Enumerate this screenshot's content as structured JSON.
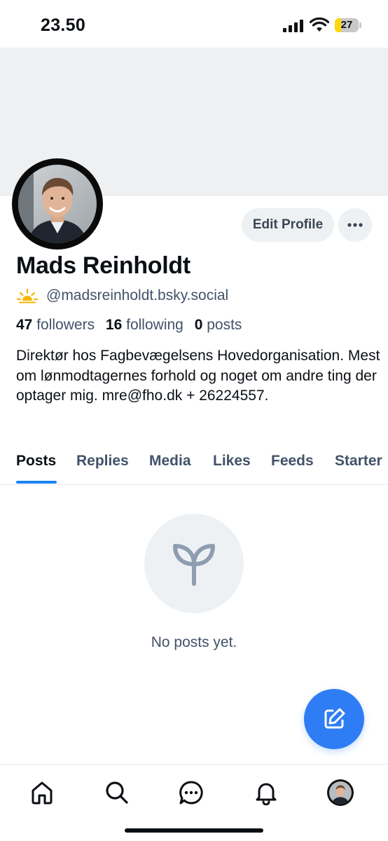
{
  "status_bar": {
    "time": "23.50",
    "battery_level": "27",
    "battery_fraction": 0.27,
    "battery_color": "#ffd60a"
  },
  "profile": {
    "display_name": "Mads Reinholdt",
    "handle": "@madsreinholdt.bsky.social",
    "handle_icon": "sun-icon",
    "stats": {
      "followers_count": "47",
      "followers_label": "followers",
      "following_count": "16",
      "following_label": "following",
      "posts_count": "0",
      "posts_label": "posts"
    },
    "bio": "Direktør hos Fagbevægelsens Hovedorganisation. Mest om lønmodtagernes forhold og noget om andre ting der optager mig. mre@fho.dk + 26224557."
  },
  "actions": {
    "edit_profile_label": "Edit Profile",
    "more_icon": "ellipsis-icon"
  },
  "tabs": {
    "items": [
      "Posts",
      "Replies",
      "Media",
      "Likes",
      "Feeds",
      "Starter"
    ],
    "active": "Posts"
  },
  "empty_state": {
    "icon": "sprout-icon",
    "message": "No posts yet."
  },
  "compose": {
    "icon": "compose-icon"
  },
  "bottom_nav": {
    "items": [
      "home-icon",
      "search-icon",
      "chat-icon",
      "bell-icon",
      "profile-avatar"
    ]
  },
  "colors": {
    "accent": "#1a84f3",
    "fab": "#2f7df4",
    "muted_text": "#42526a",
    "banner": "#eef0f2"
  }
}
